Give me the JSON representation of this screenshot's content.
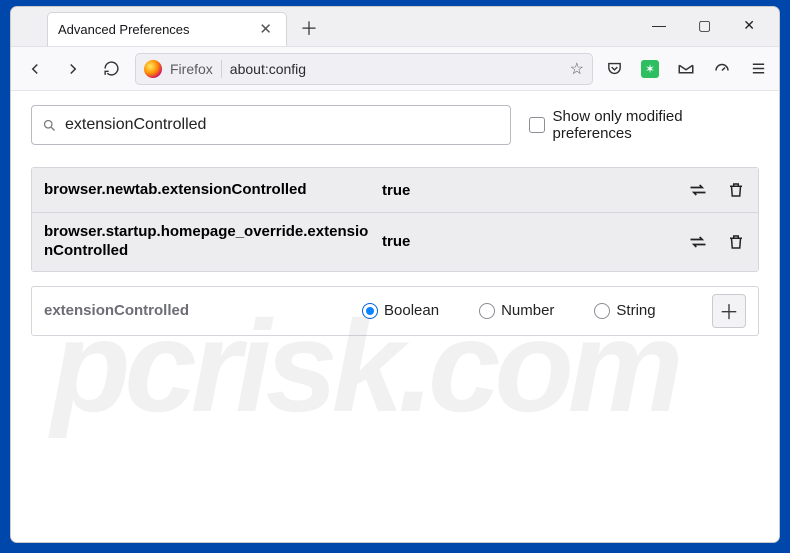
{
  "tab": {
    "title": "Advanced Preferences"
  },
  "urlbar": {
    "brand": "Firefox",
    "address": "about:config"
  },
  "content": {
    "search_value": "extensionControlled",
    "show_modified_label": "Show only modified preferences",
    "prefs": [
      {
        "name": "browser.newtab.extensionControlled",
        "value": "true"
      },
      {
        "name": "browser.startup.homepage_override.extensionControlled",
        "value": "true"
      }
    ],
    "new_pref_name": "extensionControlled",
    "type_options": {
      "boolean": "Boolean",
      "number": "Number",
      "string": "String"
    }
  },
  "watermark": "pcrisk.com"
}
